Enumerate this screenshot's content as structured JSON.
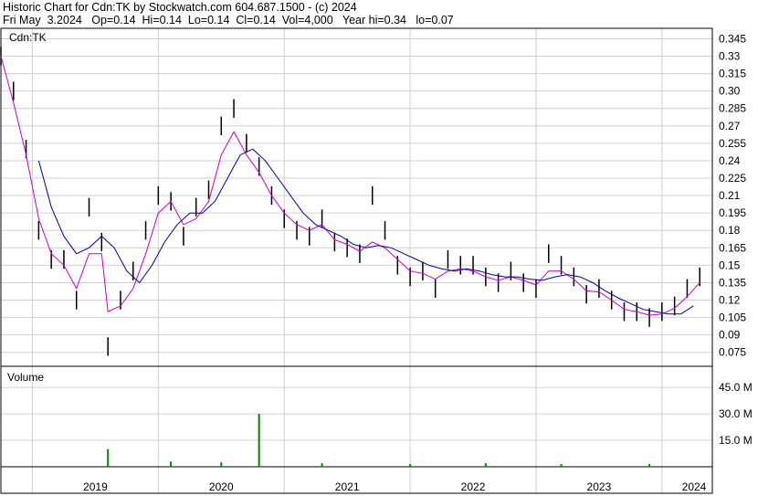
{
  "header": {
    "line1": "Historic Chart for Cdn:TK by Stockwatch.com 604.687.1500 - (c) 2024",
    "line2": "Fri May  3.2024   Op=0.14  Hi=0.14  Lo=0.14  Cl=0.14  Vol=4,000   Year hi=0.34   lo=0.07"
  },
  "chart_data": [
    {
      "type": "line",
      "title": "Cdn:TK",
      "price_axis_ticks": [
        "0.345",
        "0.33",
        "0.315",
        "0.30",
        "0.285",
        "0.27",
        "0.255",
        "0.24",
        "0.225",
        "0.21",
        "0.195",
        "0.18",
        "0.165",
        "0.15",
        "0.135",
        "0.12",
        "0.105",
        "0.09",
        "0.075"
      ],
      "ylim": [
        0.063,
        0.354
      ],
      "x_labels": [
        "2019",
        "2020",
        "2021",
        "2022",
        "2023",
        "2024"
      ],
      "grid": true,
      "series": [
        {
          "role": "price-high-low-bars",
          "color": "#000000",
          "x": [
            2018.75,
            2018.85,
            2018.95,
            2019.05,
            2019.15,
            2019.25,
            2019.35,
            2019.45,
            2019.55,
            2019.6,
            2019.7,
            2019.8,
            2019.9,
            2020.0,
            2020.1,
            2020.2,
            2020.3,
            2020.4,
            2020.5,
            2020.6,
            2020.7,
            2020.8,
            2020.9,
            2021.0,
            2021.1,
            2021.2,
            2021.3,
            2021.4,
            2021.5,
            2021.6,
            2021.7,
            2021.8,
            2021.9,
            2022.0,
            2022.1,
            2022.2,
            2022.3,
            2022.4,
            2022.5,
            2022.6,
            2022.7,
            2022.8,
            2022.9,
            2023.0,
            2023.1,
            2023.2,
            2023.3,
            2023.4,
            2023.5,
            2023.6,
            2023.7,
            2023.8,
            2023.9,
            2024.0,
            2024.1,
            2024.2,
            2024.3
          ],
          "values": [
            0.33,
            0.3,
            0.25,
            0.18,
            0.155,
            0.155,
            0.12,
            0.2,
            0.17,
            0.08,
            0.12,
            0.145,
            0.18,
            0.21,
            0.205,
            0.175,
            0.2,
            0.215,
            0.27,
            0.285,
            0.255,
            0.235,
            0.21,
            0.19,
            0.18,
            0.175,
            0.19,
            0.17,
            0.165,
            0.16,
            0.21,
            0.18,
            0.15,
            0.14,
            0.145,
            0.13,
            0.155,
            0.15,
            0.15,
            0.14,
            0.135,
            0.145,
            0.135,
            0.13,
            0.16,
            0.15,
            0.14,
            0.125,
            0.13,
            0.12,
            0.11,
            0.11,
            0.105,
            0.11,
            0.115,
            0.13,
            0.14
          ]
        },
        {
          "role": "short-moving-average",
          "color": "#cc00cc",
          "x": [
            2018.75,
            2018.85,
            2018.95,
            2019.05,
            2019.15,
            2019.25,
            2019.35,
            2019.45,
            2019.55,
            2019.6,
            2019.7,
            2019.8,
            2019.9,
            2020.0,
            2020.1,
            2020.2,
            2020.3,
            2020.4,
            2020.5,
            2020.6,
            2020.7,
            2020.8,
            2020.9,
            2021.0,
            2021.1,
            2021.2,
            2021.3,
            2021.4,
            2021.5,
            2021.6,
            2021.7,
            2021.8,
            2021.9,
            2022.0,
            2022.1,
            2022.2,
            2022.3,
            2022.4,
            2022.5,
            2022.6,
            2022.7,
            2022.8,
            2022.9,
            2023.0,
            2023.1,
            2023.2,
            2023.3,
            2023.4,
            2023.5,
            2023.6,
            2023.7,
            2023.8,
            2023.9,
            2024.0,
            2024.1,
            2024.2,
            2024.3
          ],
          "values": [
            0.33,
            0.29,
            0.245,
            0.19,
            0.16,
            0.15,
            0.13,
            0.16,
            0.16,
            0.11,
            0.115,
            0.13,
            0.16,
            0.195,
            0.205,
            0.185,
            0.19,
            0.205,
            0.245,
            0.265,
            0.245,
            0.23,
            0.21,
            0.195,
            0.185,
            0.18,
            0.185,
            0.172,
            0.168,
            0.162,
            0.17,
            0.165,
            0.155,
            0.145,
            0.143,
            0.138,
            0.145,
            0.147,
            0.145,
            0.14,
            0.137,
            0.14,
            0.137,
            0.133,
            0.145,
            0.145,
            0.138,
            0.128,
            0.127,
            0.12,
            0.112,
            0.11,
            0.107,
            0.108,
            0.113,
            0.123,
            0.135
          ]
        },
        {
          "role": "long-moving-average",
          "color": "#0000aa",
          "x": [
            2019.05,
            2019.15,
            2019.25,
            2019.35,
            2019.45,
            2019.55,
            2019.65,
            2019.75,
            2019.85,
            2019.95,
            2020.05,
            2020.15,
            2020.25,
            2020.35,
            2020.45,
            2020.55,
            2020.65,
            2020.75,
            2020.85,
            2020.95,
            2021.05,
            2021.15,
            2021.25,
            2021.35,
            2021.45,
            2021.55,
            2021.65,
            2021.75,
            2021.85,
            2021.95,
            2022.05,
            2022.15,
            2022.25,
            2022.35,
            2022.45,
            2022.55,
            2022.65,
            2022.75,
            2022.85,
            2022.95,
            2023.05,
            2023.15,
            2023.25,
            2023.35,
            2023.45,
            2023.55,
            2023.65,
            2023.75,
            2023.85,
            2023.95,
            2024.05,
            2024.15,
            2024.25
          ],
          "values": [
            0.24,
            0.2,
            0.175,
            0.16,
            0.165,
            0.175,
            0.165,
            0.145,
            0.135,
            0.15,
            0.17,
            0.185,
            0.195,
            0.195,
            0.205,
            0.225,
            0.245,
            0.25,
            0.24,
            0.225,
            0.21,
            0.195,
            0.185,
            0.18,
            0.175,
            0.168,
            0.165,
            0.167,
            0.165,
            0.16,
            0.155,
            0.15,
            0.147,
            0.145,
            0.147,
            0.145,
            0.142,
            0.14,
            0.14,
            0.138,
            0.137,
            0.14,
            0.142,
            0.14,
            0.135,
            0.128,
            0.122,
            0.117,
            0.112,
            0.11,
            0.108,
            0.108,
            0.115
          ]
        }
      ]
    },
    {
      "type": "bar",
      "title": "Volume",
      "volume_axis_ticks": [
        "45.0 M",
        "30.0 M",
        "15.0 M"
      ],
      "ylim": [
        0,
        57
      ],
      "grid": true,
      "series": [
        {
          "role": "volume",
          "color": "#008800",
          "x": [
            2019.6,
            2020.1,
            2020.5,
            2020.8,
            2021.3,
            2022.0,
            2022.6,
            2023.2,
            2023.9
          ],
          "values": [
            10,
            3,
            2.5,
            30,
            2,
            1.5,
            2,
            1.5,
            1.5
          ]
        }
      ]
    }
  ]
}
